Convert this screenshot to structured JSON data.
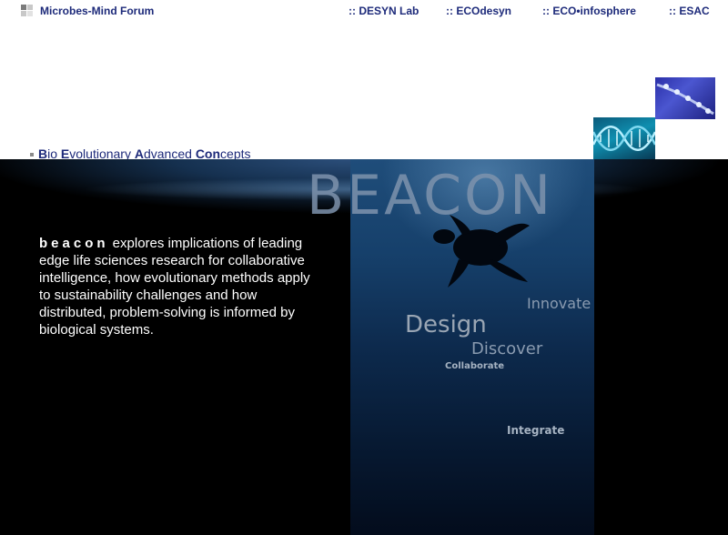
{
  "header": {
    "site_title": "Microbes-Mind Forum",
    "nav": [
      {
        "label": ":: DESYN Lab"
      },
      {
        "label": ":: ECOdesyn"
      },
      {
        "label": ":: ECO•infosphere"
      },
      {
        "label": ":: ESAC"
      }
    ]
  },
  "tagline": {
    "b1": "B",
    "r1": "io ",
    "b2": "E",
    "r2": "volutionary ",
    "b3": "A",
    "r3": "dvanced ",
    "b4": "Con",
    "r4": "cepts"
  },
  "hero": {
    "title": "BEACON",
    "keyword": "beacon",
    "description": " explores implications of leading edge life sciences research for collaborative intelligence, how evolutionary methods apply to sustainability challenges and how distributed, problem-solving is informed by biological systems.",
    "words": {
      "innovate": "Innovate",
      "design": "Design",
      "discover": "Discover",
      "collaborate": "Collaborate",
      "integrate": "Integrate"
    }
  },
  "colors": {
    "nav_text": "#1d2a7a",
    "hero_bg": "#000000",
    "hero_text": "#ffffff"
  },
  "icons": [
    "logo-squares-icon",
    "abstract-blue-image",
    "dna-helix-image",
    "turtle-silhouette"
  ]
}
